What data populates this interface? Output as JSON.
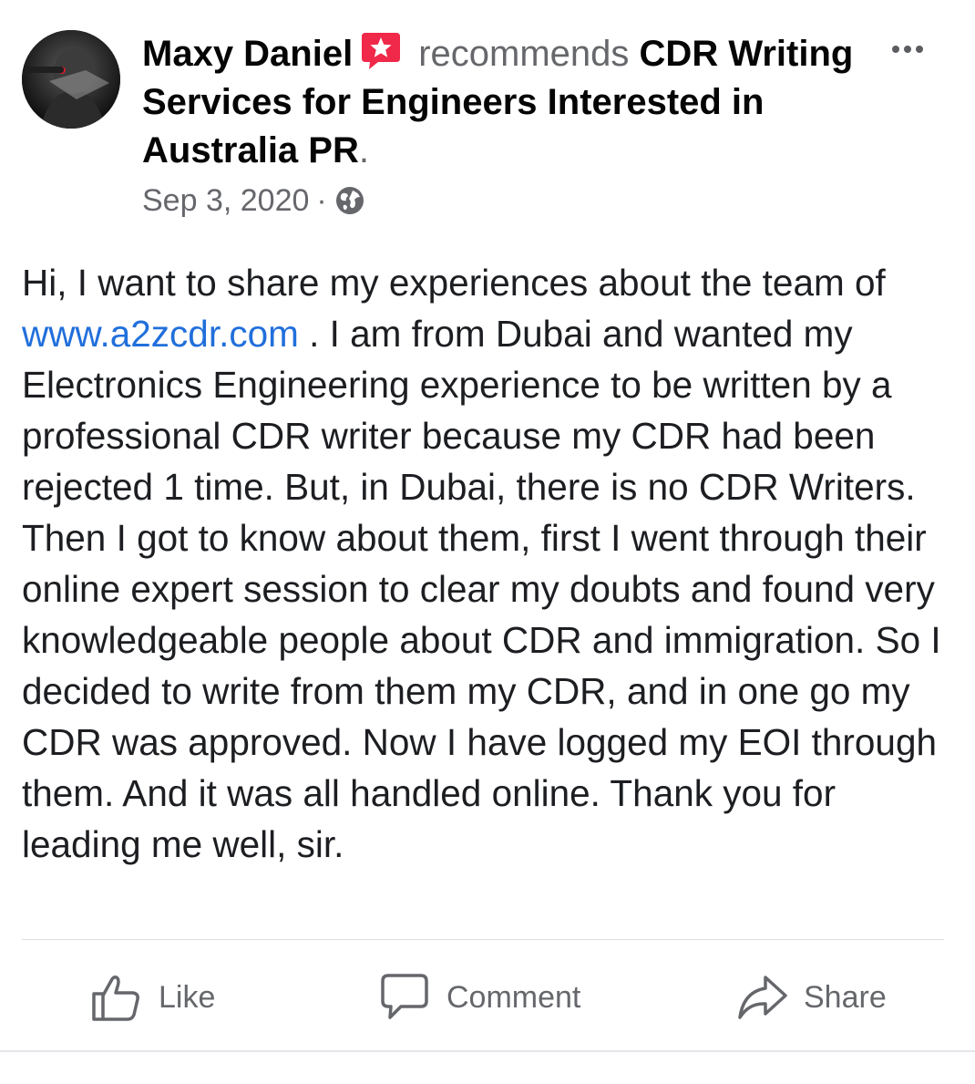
{
  "post": {
    "author": "Maxy Daniel",
    "verb": "recommends",
    "page": "CDR Writing Services for Engineers Interested in Australia PR",
    "page_end": ".",
    "date": "Sep 3, 2020",
    "separator": "·",
    "body_before_link": "Hi, I want to share my experiences about the team of ",
    "link": "www.a2zcdr.com",
    "body_after_link": " . I am from Dubai and wanted my Electronics Engineering experience to be written by a professional CDR writer because my CDR had been rejected 1 time. But, in Dubai, there is no CDR Writers. Then I got to know about them, first I went through their online expert session to clear my doubts and found very knowledgeable people about CDR and immigration. So I decided to write from them my CDR, and in one go my CDR was approved. Now I have logged my EOI through them. And it was all handled online. Thank you for leading me well, sir."
  },
  "actions": {
    "like": "Like",
    "comment": "Comment",
    "share": "Share"
  },
  "icons": {
    "recommend_badge": "recommend-star-icon",
    "privacy": "globe-icon",
    "more": "more-options-icon",
    "like": "thumbs-up-icon",
    "comment": "speech-bubble-icon",
    "share": "share-arrow-icon"
  },
  "colors": {
    "link": "#216fdb",
    "badge": "#f02849",
    "secondary_text": "#65676b"
  }
}
